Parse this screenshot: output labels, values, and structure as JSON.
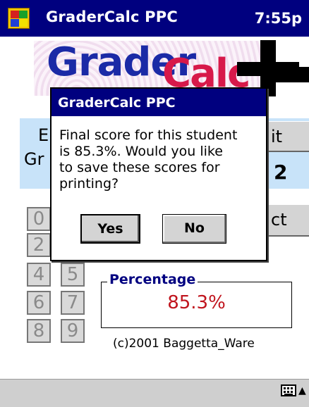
{
  "title_bar": {
    "app_title": "GraderCalc PPC",
    "clock": "7:55p"
  },
  "logo": {
    "word1": "Grader",
    "word2": "Calc"
  },
  "background_fragments": {
    "e": "E",
    "gr": "Gr",
    "it": "it",
    "two": "2",
    "ct": "ct"
  },
  "keypad": [
    {
      "label": "0"
    },
    {
      "label": "2"
    },
    {
      "label": "4"
    },
    {
      "label": "5"
    },
    {
      "label": "6"
    },
    {
      "label": "7"
    },
    {
      "label": "8"
    },
    {
      "label": "9"
    }
  ],
  "percentage": {
    "legend": "Percentage",
    "value": "85.3%"
  },
  "copyright": "(c)2001 Baggetta_Ware",
  "dialog": {
    "title": "GraderCalc PPC",
    "message": "Final score for this student\nis 85.3%. Would you like\nto save these scores for\nprinting?",
    "yes_label": "Yes",
    "no_label": "No"
  },
  "colors": {
    "titlebar": "#00007f",
    "percentage_value": "#c0141d",
    "info_panel": "#c8e3f9"
  },
  "icons": {
    "start": "windows-flag-icon",
    "keyboard": "keyboard-icon",
    "sip_toggle": "chevron-up-icon"
  }
}
